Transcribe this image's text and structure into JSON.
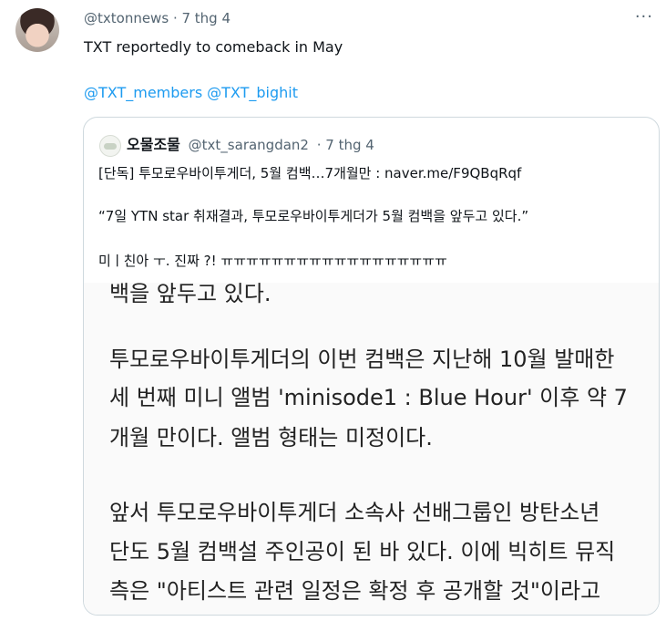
{
  "tweet": {
    "handle": "@txtonnews",
    "time": "· 7 thg 4",
    "more": "···",
    "text": "TXT reportedly to comeback in May",
    "mentions": [
      "@TXT_members",
      "@TXT_bighit"
    ]
  },
  "quote": {
    "name": "오물조물",
    "handle": "@txt_sarangdan2",
    "time": "· 7 thg 4",
    "line1": "[단독] 투모로우바이투게더, 5월 컴백…7개월만 : naver.me/F9QBqRqf",
    "line2": "“7일 YTN star 취재결과, 투모로우바이투게더가 5월 컴백을 앞두고 있다.”",
    "line3": "미ㅣ친아 ㅜ. 진짜 ?! ㅠㅠㅠㅠㅠㅠㅠㅠㅠㅠㅠㅠㅠㅠㅠㅠㅠㅠ"
  },
  "image": {
    "lines": [
      "백을 앞두고 있다.",
      "투모로우바이투게더의 이번 컴백은 지난해 10월 발매한",
      "세 번째 미니 앨범 'minisode1 : Blue Hour' 이후 약 7",
      "개월 만이다. 앨범 형태는 미정이다.",
      "앞서 투모로우바이투게더 소속사 선배그룹인 방탄소년",
      "단도 5월 컴백설 주인공이 된 바 있다. 이에 빅히트 뮤직",
      "측은 \"아티스트 관련 일정은 확정 후 공개할 것\"이라고"
    ]
  }
}
